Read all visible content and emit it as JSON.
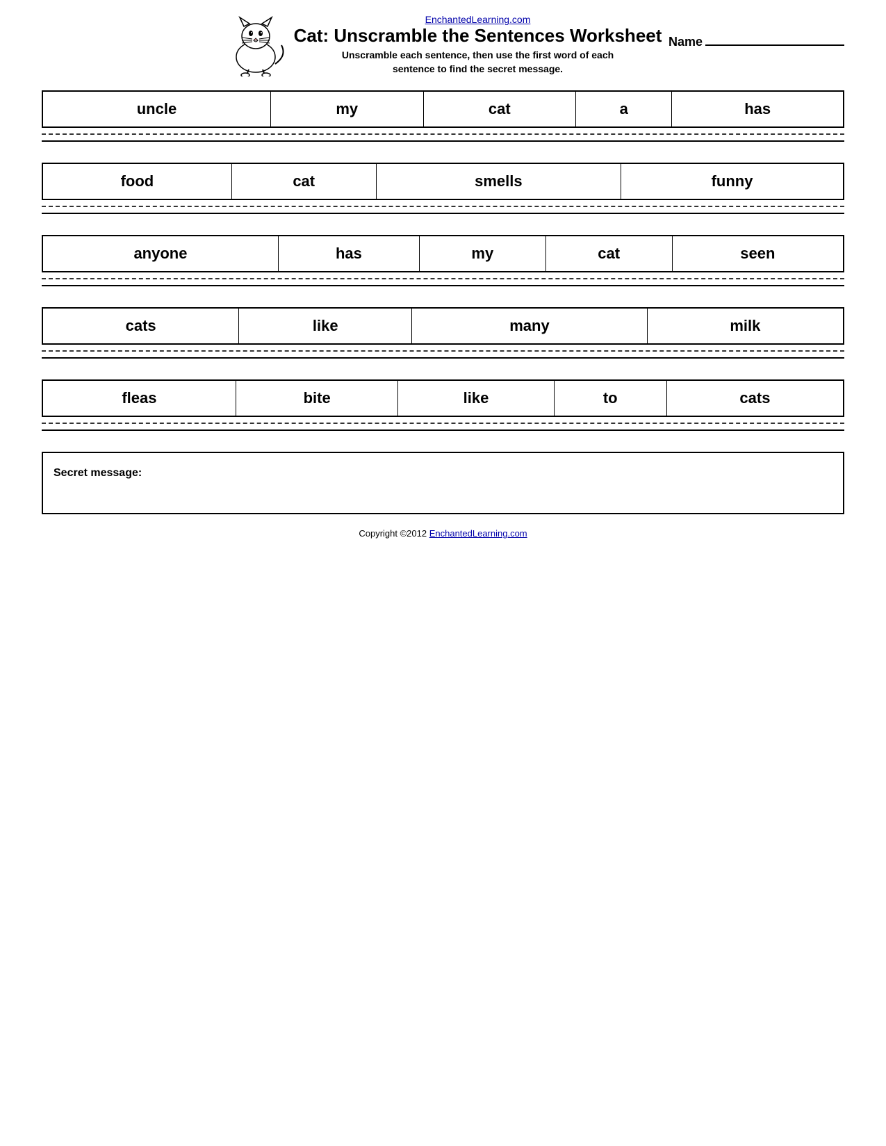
{
  "header": {
    "site_link": "EnchantedLearning.com",
    "title": "Cat: Unscramble the Sentences Worksheet",
    "subtitle_line1": "Unscramble each sentence, then use the first word of each",
    "subtitle_line2": "sentence to find the secret message.",
    "name_label": "Name"
  },
  "sentences": [
    {
      "id": 1,
      "words": [
        "uncle",
        "my",
        "cat",
        "a",
        "has"
      ]
    },
    {
      "id": 2,
      "words": [
        "food",
        "cat",
        "smells",
        "funny"
      ]
    },
    {
      "id": 3,
      "words": [
        "anyone",
        "has",
        "my",
        "cat",
        "seen"
      ]
    },
    {
      "id": 4,
      "words": [
        "cats",
        "like",
        "many",
        "milk"
      ]
    },
    {
      "id": 5,
      "words": [
        "fleas",
        "bite",
        "like",
        "to",
        "cats"
      ]
    }
  ],
  "secret_message": {
    "label": "Secret message:"
  },
  "footer": {
    "copyright": "Copyright ©2012 EnchantedLearning.com",
    "copyright_link": "EnchantedLearning.com"
  }
}
